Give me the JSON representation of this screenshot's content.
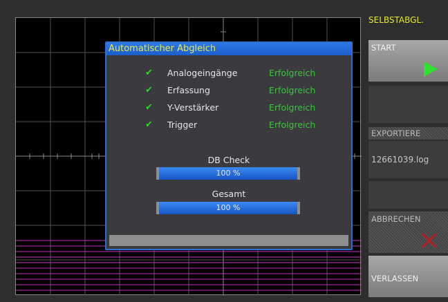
{
  "sidebar": {
    "title": "SELBSTABGL.",
    "start_label": "START",
    "export_label": "EXPORTIERE",
    "export_file": "12661039.log",
    "cancel_label": "ABBRECHEN",
    "leave_label": "VERLASSEN"
  },
  "dialog": {
    "title": "Automatischer Abgleich",
    "rows": [
      {
        "label": "Analogeingänge",
        "status": "Erfolgreich"
      },
      {
        "label": "Erfassung",
        "status": "Erfolgreich"
      },
      {
        "label": "Y-Verstärker",
        "status": "Erfolgreich"
      },
      {
        "label": "Trigger",
        "status": "Erfolgreich"
      }
    ],
    "progress": [
      {
        "label": "DB Check",
        "value_text": "100 %",
        "value": 100
      },
      {
        "label": "Gesamt",
        "value_text": "100 %",
        "value": 100
      }
    ]
  },
  "colors": {
    "accent": "#2f78e6",
    "success": "#37c837",
    "title_yellow": "#e8e83a",
    "trace": "#c433c4"
  }
}
